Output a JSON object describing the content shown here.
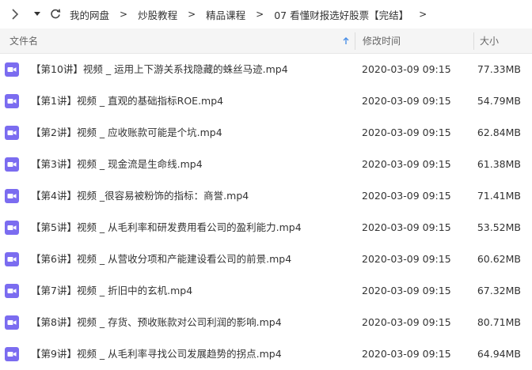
{
  "toolbar": {
    "breadcrumb": [
      "我的网盘",
      "炒股教程",
      "精品课程",
      "07 看懂财报选好股票【完结】"
    ],
    "separator": ">",
    "trailing_separator": ">"
  },
  "columns": {
    "name": "文件名",
    "modified": "修改时间",
    "size": "大小"
  },
  "colors": {
    "video_icon": "#7b6cf0",
    "header_bg": "#f5f5f5",
    "sort_arrow": "#4a8fe7"
  },
  "files": [
    {
      "name": "【第10讲】视频 _ 运用上下游关系找隐藏的蛛丝马迹.mp4",
      "modified": "2020-03-09 09:15",
      "size": "77.33MB",
      "icon": "video-file-icon"
    },
    {
      "name": "【第1讲】视频 _ 直观的基础指标ROE.mp4",
      "modified": "2020-03-09 09:15",
      "size": "54.79MB",
      "icon": "video-file-icon"
    },
    {
      "name": "【第2讲】视频 _ 应收账款可能是个坑.mp4",
      "modified": "2020-03-09 09:15",
      "size": "62.84MB",
      "icon": "video-file-icon"
    },
    {
      "name": "【第3讲】视频 _ 现金流是生命线.mp4",
      "modified": "2020-03-09 09:15",
      "size": "61.38MB",
      "icon": "video-file-icon"
    },
    {
      "name": "【第4讲】视频 _很容易被粉饰的指标：商誉.mp4",
      "modified": "2020-03-09 09:15",
      "size": "71.41MB",
      "icon": "video-file-icon"
    },
    {
      "name": "【第5讲】视频 _ 从毛利率和研发费用看公司的盈利能力.mp4",
      "modified": "2020-03-09 09:15",
      "size": "53.52MB",
      "icon": "video-file-icon"
    },
    {
      "name": "【第6讲】视频 _ 从营收分项和产能建设看公司的前景.mp4",
      "modified": "2020-03-09 09:15",
      "size": "60.62MB",
      "icon": "video-file-icon"
    },
    {
      "name": "【第7讲】视频 _ 折旧中的玄机.mp4",
      "modified": "2020-03-09 09:15",
      "size": "67.32MB",
      "icon": "video-file-icon"
    },
    {
      "name": "【第8讲】视频 _ 存货、预收账款对公司利润的影响.mp4",
      "modified": "2020-03-09 09:15",
      "size": "80.71MB",
      "icon": "video-file-icon"
    },
    {
      "name": "【第9讲】视频 _ 从毛利率寻找公司发展趋势的拐点.mp4",
      "modified": "2020-03-09 09:15",
      "size": "64.94MB",
      "icon": "video-file-icon"
    }
  ]
}
